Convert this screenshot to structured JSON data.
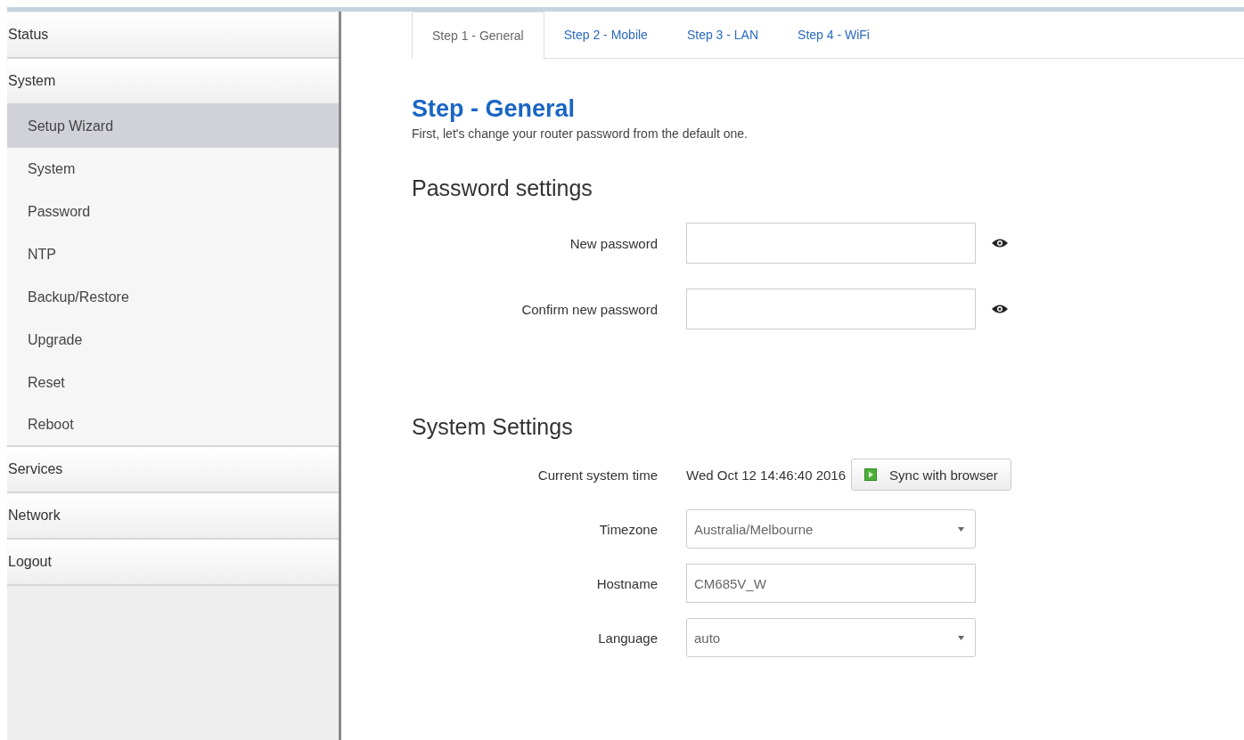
{
  "sidebar": {
    "items": [
      {
        "label": "Status",
        "kind": "section",
        "selected": false
      },
      {
        "label": "System",
        "kind": "section",
        "selected": false
      },
      {
        "label": "Setup Wizard",
        "kind": "sub",
        "selected": true
      },
      {
        "label": "System",
        "kind": "sub",
        "selected": false
      },
      {
        "label": "Password",
        "kind": "sub",
        "selected": false
      },
      {
        "label": "NTP",
        "kind": "sub",
        "selected": false
      },
      {
        "label": "Backup/Restore",
        "kind": "sub",
        "selected": false
      },
      {
        "label": "Upgrade",
        "kind": "sub",
        "selected": false
      },
      {
        "label": "Reset",
        "kind": "sub",
        "selected": false
      },
      {
        "label": "Reboot",
        "kind": "sub",
        "selected": false
      },
      {
        "label": "Services",
        "kind": "section",
        "selected": false
      },
      {
        "label": "Network",
        "kind": "section",
        "selected": false
      },
      {
        "label": "Logout",
        "kind": "section",
        "selected": false
      }
    ]
  },
  "tabs": [
    {
      "label": "Step 1 - General",
      "selected": true
    },
    {
      "label": "Step 2 - Mobile",
      "selected": false
    },
    {
      "label": "Step 3 - LAN",
      "selected": false
    },
    {
      "label": "Step 4 - WiFi",
      "selected": false
    }
  ],
  "heading": "Step - General",
  "description": "First, let's change your router password from the default one.",
  "sections": [
    {
      "title": "Password settings",
      "fields": [
        {
          "label": "New password",
          "kind": "password"
        },
        {
          "label": "Confirm new password",
          "kind": "password"
        }
      ]
    },
    {
      "title": "System Settings",
      "fields": [
        {
          "label": "Current system time",
          "kind": "time",
          "value": "Wed Oct 12 14:46:40 2016",
          "button": "Sync with browser"
        },
        {
          "label": "Timezone",
          "kind": "select",
          "value": "Australia/Melbourne"
        },
        {
          "label": "Hostname",
          "kind": "text",
          "value": "CM685V_W"
        },
        {
          "label": "Language",
          "kind": "select",
          "value": "auto"
        }
      ]
    }
  ]
}
